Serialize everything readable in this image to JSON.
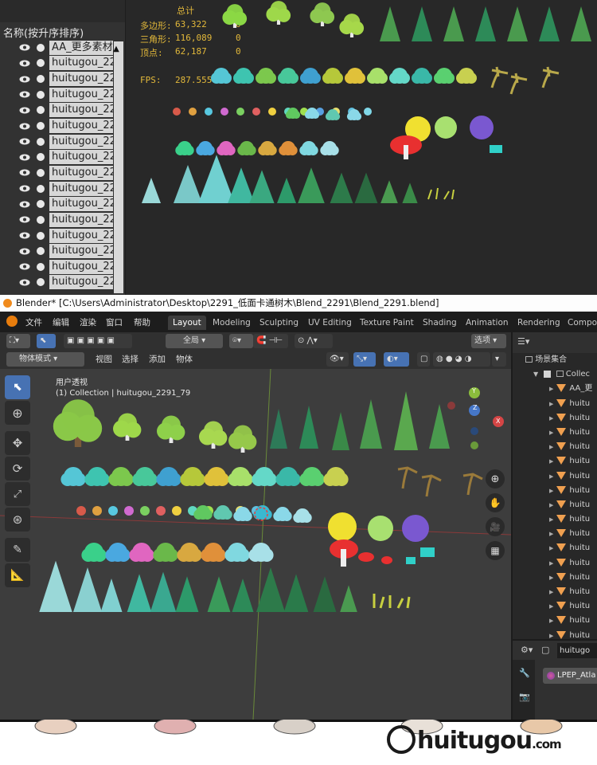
{
  "outliner": {
    "title": "名称(按升序排序)",
    "items": [
      {
        "label": "AA_更多素材"
      },
      {
        "label": "huitugou_22"
      },
      {
        "label": "huitugou_22"
      },
      {
        "label": "huitugou_22"
      },
      {
        "label": "huitugou_22"
      },
      {
        "label": "huitugou_22"
      },
      {
        "label": "huitugou_22"
      },
      {
        "label": "huitugou_22"
      },
      {
        "label": "huitugou_22"
      },
      {
        "label": "huitugou_22"
      },
      {
        "label": "huitugou_22"
      },
      {
        "label": "huitugou_22"
      },
      {
        "label": "huitugou_22"
      },
      {
        "label": "huitugou_22"
      },
      {
        "label": "huitugou_22"
      },
      {
        "label": "huitugou_22"
      }
    ]
  },
  "stats": {
    "total_label": "总计",
    "polys_label": "多边形:",
    "polys": "63,322",
    "polys_sel": "0",
    "tris_label": "三角形:",
    "tris": "116,089",
    "tris_sel": "0",
    "verts_label": "顶点:",
    "verts": "62,187",
    "verts_sel": "0",
    "fps_label": "FPS:",
    "fps": "287.555"
  },
  "window": {
    "title": "Blender* [C:\\Users\\Administrator\\Desktop\\2291_低面卡通树木\\Blend_2291\\Blend_2291.blend]"
  },
  "menu": [
    "文件",
    "编辑",
    "渲染",
    "窗口",
    "帮助"
  ],
  "workspaces": [
    {
      "label": "Layout",
      "active": true
    },
    {
      "label": "Modeling"
    },
    {
      "label": "Sculpting"
    },
    {
      "label": "UV Editing"
    },
    {
      "label": "Texture Paint"
    },
    {
      "label": "Shading"
    },
    {
      "label": "Animation"
    },
    {
      "label": "Rendering"
    },
    {
      "label": "Compos"
    }
  ],
  "header1": {
    "orientation": "全局",
    "options": "选项"
  },
  "header2": {
    "mode": "物体模式",
    "menus": [
      "视图",
      "选择",
      "添加",
      "物体"
    ]
  },
  "viewport": {
    "view_name": "用户透视",
    "collection_info": "(1) Collection | huitugou_2291_79",
    "gizmo": {
      "x": "X",
      "y": "Y",
      "z": "Z"
    }
  },
  "scene_outliner": {
    "root": "场景集合",
    "collection": "Collec",
    "items": [
      "AA_更",
      "huitu",
      "huitu",
      "huitu",
      "huitu",
      "huitu",
      "huitu",
      "huitu",
      "huitu",
      "huitu",
      "huitu",
      "huitu",
      "huitu",
      "huitu",
      "huitu",
      "huitu",
      "huitu",
      "huitu"
    ]
  },
  "properties": {
    "object": "huitugo",
    "material": "LPEP_Atla"
  },
  "watermark": {
    "brand": "huitugou",
    "suffix": ".com"
  },
  "colors": {
    "accent": "#4772b3",
    "stat": "#e2b83a",
    "x_axis": "#d54545",
    "y_axis": "#8bbd3c",
    "z_axis": "#4677c8"
  }
}
